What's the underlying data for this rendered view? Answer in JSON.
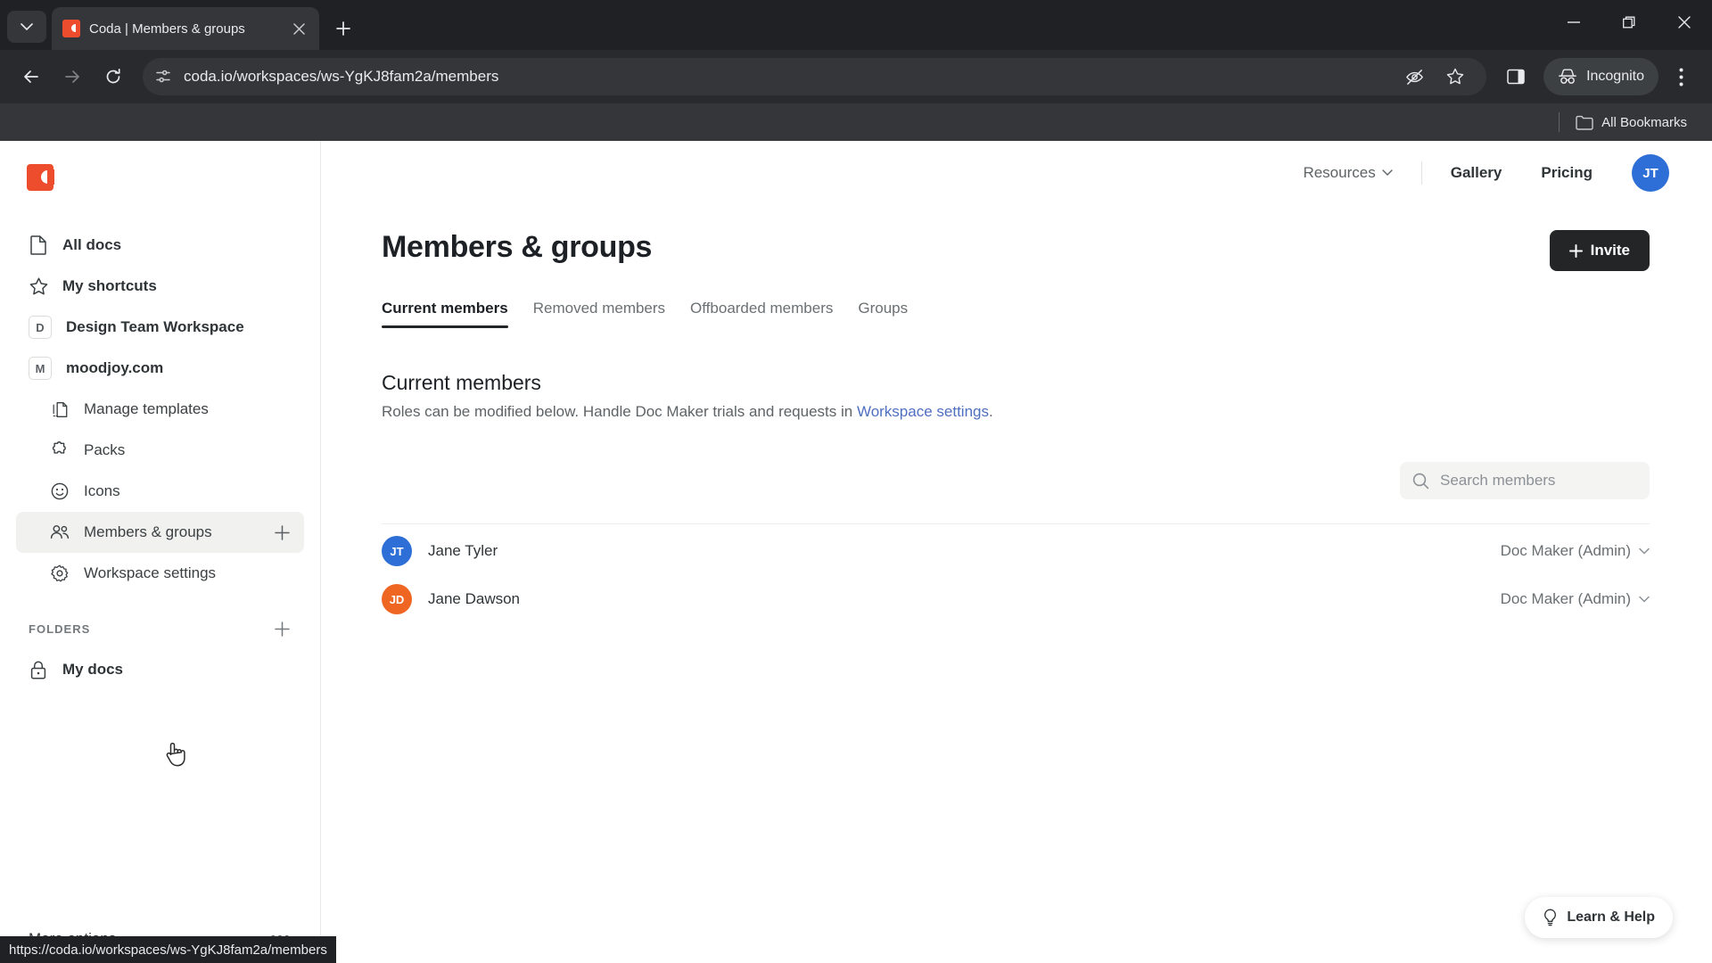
{
  "browser": {
    "tab": {
      "title": "Coda | Members & groups",
      "favicon": "coda-favicon"
    },
    "omnibox": {
      "url": "coda.io/workspaces/ws-YgKJ8fam2a/members"
    },
    "incognito_label": "Incognito",
    "bookmarks_label": "All Bookmarks",
    "status_url": "https://coda.io/workspaces/ws-YgKJ8fam2a/members"
  },
  "sidebar": {
    "items": [
      {
        "label": "All docs",
        "icon": "document-icon",
        "type": "icon"
      },
      {
        "label": "My shortcuts",
        "icon": "star-icon",
        "type": "icon"
      },
      {
        "label": "Design Team Workspace",
        "icon": "D",
        "type": "badge"
      },
      {
        "label": "moodjoy.com",
        "icon": "M",
        "type": "badge"
      }
    ],
    "sub_items": [
      {
        "label": "Manage templates",
        "icon": "template-icon"
      },
      {
        "label": "Packs",
        "icon": "puzzle-icon"
      },
      {
        "label": "Icons",
        "icon": "smiley-icon"
      },
      {
        "label": "Members & groups",
        "icon": "people-icon",
        "active": true,
        "plus": true
      },
      {
        "label": "Workspace settings",
        "icon": "gear-icon"
      }
    ],
    "folders_header": "FOLDERS",
    "folders": [
      {
        "label": "My docs",
        "icon": "lock-icon"
      }
    ],
    "more_options": "More options"
  },
  "topnav": {
    "resources": "Resources",
    "gallery": "Gallery",
    "pricing": "Pricing",
    "avatar": {
      "initials": "JT",
      "color": "#2d6fd6"
    }
  },
  "main": {
    "title": "Members & groups",
    "invite_label": "Invite",
    "tabs": [
      {
        "label": "Current members",
        "active": true
      },
      {
        "label": "Removed members",
        "active": false
      },
      {
        "label": "Offboarded members",
        "active": false
      },
      {
        "label": "Groups",
        "active": false
      }
    ],
    "section_title": "Current members",
    "section_desc_before": "Roles can be modified below. Handle Doc Maker trials and requests in ",
    "section_desc_link": "Workspace settings",
    "section_desc_after": ".",
    "search_placeholder": "Search members",
    "members": [
      {
        "initials": "JT",
        "name": "Jane Tyler",
        "role": "Doc Maker (Admin)",
        "color": "#2d6fd6"
      },
      {
        "initials": "JD",
        "name": "Jane Dawson",
        "role": "Doc Maker (Admin)",
        "color": "#ee6622"
      }
    ],
    "learn_help": "Learn & Help"
  },
  "colors": {
    "brand_orange": "#ee4d2d",
    "link_blue": "#4f6fc0",
    "dark_button": "#242527"
  }
}
